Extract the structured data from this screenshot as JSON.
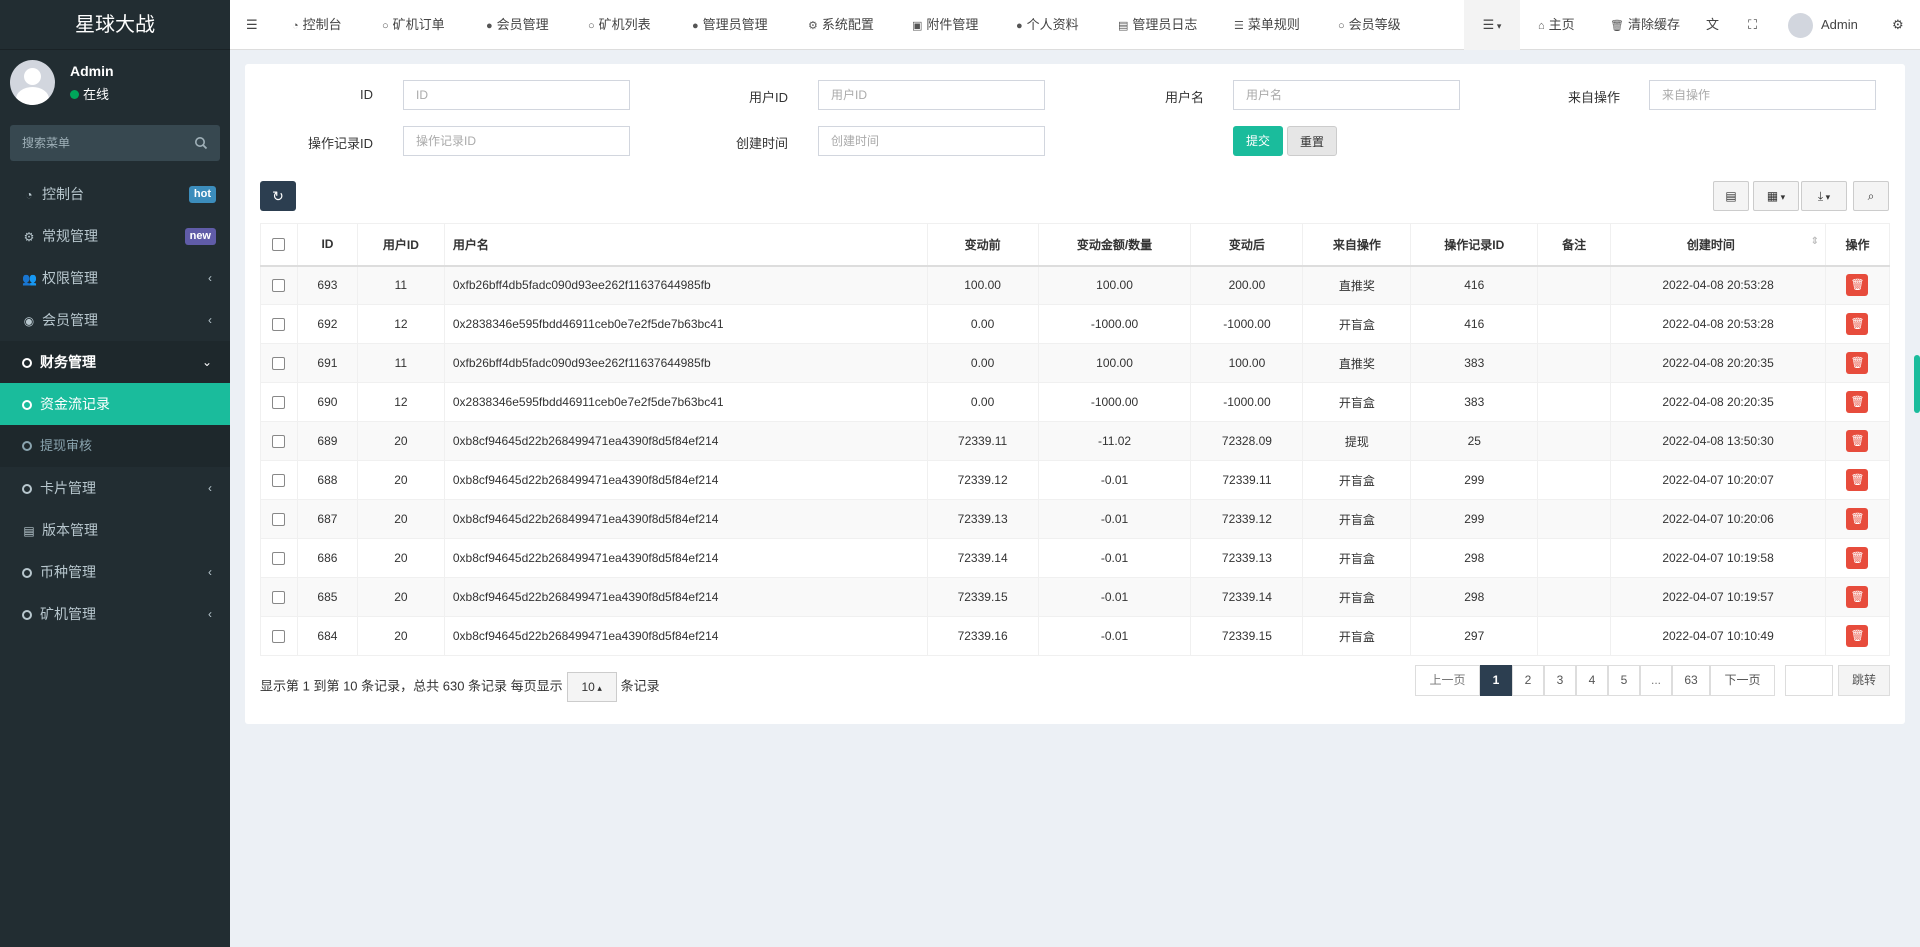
{
  "brand": "星球大战",
  "user": {
    "name": "Admin",
    "status": "在线"
  },
  "sidebar": {
    "search_placeholder": "搜索菜单",
    "items": [
      {
        "label": "控制台",
        "icon": "dashboard-icon",
        "badge": "hot",
        "badge_color": "#3c8dbc"
      },
      {
        "label": "常规管理",
        "icon": "cogs-icon",
        "badge": "new",
        "badge_color": "#605ca8"
      },
      {
        "label": "权限管理",
        "icon": "group-icon"
      },
      {
        "label": "会员管理",
        "icon": "user-circle-icon"
      },
      {
        "label": "财务管理",
        "icon": "circle-icon"
      },
      {
        "label": "资金流记录",
        "icon": "circle-icon"
      },
      {
        "label": "提现审核",
        "icon": "circle-icon"
      },
      {
        "label": "卡片管理",
        "icon": "circle-icon"
      },
      {
        "label": "版本管理",
        "icon": "file-icon"
      },
      {
        "label": "币种管理",
        "icon": "circle-icon"
      },
      {
        "label": "矿机管理",
        "icon": "circle-icon"
      }
    ]
  },
  "topnav": {
    "tabs": [
      "控制台",
      "矿机订单",
      "会员管理",
      "矿机列表",
      "管理员管理",
      "系统配置",
      "附件管理",
      "个人资料",
      "管理员日志",
      "菜单规则",
      "会员等级"
    ],
    "home": "主页",
    "clear_cache": "清除缓存",
    "admin": "Admin"
  },
  "filters": {
    "id_label": "ID",
    "id_placeholder": "ID",
    "uid_label": "用户ID",
    "uid_placeholder": "用户ID",
    "uname_label": "用户名",
    "uname_placeholder": "用户名",
    "from_label": "来自操作",
    "from_placeholder": "来自操作",
    "rec_label": "操作记录ID",
    "rec_placeholder": "操作记录ID",
    "time_label": "创建时间",
    "time_placeholder": "创建时间",
    "submit": "提交",
    "reset": "重置"
  },
  "table": {
    "headers": [
      "ID",
      "用户ID",
      "用户名",
      "变动前",
      "变动金额/数量",
      "变动后",
      "来自操作",
      "操作记录ID",
      "备注",
      "创建时间",
      "操作"
    ],
    "rows": [
      [
        "693",
        "11",
        "0xfb26bff4db5fadc090d93ee262f11637644985fb",
        "100.00",
        "100.00",
        "200.00",
        "直推奖",
        "416",
        "",
        "2022-04-08 20:53:28"
      ],
      [
        "692",
        "12",
        "0x2838346e595fbdd46911ceb0e7e2f5de7b63bc41",
        "0.00",
        "-1000.00",
        "-1000.00",
        "开盲盒",
        "416",
        "",
        "2022-04-08 20:53:28"
      ],
      [
        "691",
        "11",
        "0xfb26bff4db5fadc090d93ee262f11637644985fb",
        "0.00",
        "100.00",
        "100.00",
        "直推奖",
        "383",
        "",
        "2022-04-08 20:20:35"
      ],
      [
        "690",
        "12",
        "0x2838346e595fbdd46911ceb0e7e2f5de7b63bc41",
        "0.00",
        "-1000.00",
        "-1000.00",
        "开盲盒",
        "383",
        "",
        "2022-04-08 20:20:35"
      ],
      [
        "689",
        "20",
        "0xb8cf94645d22b268499471ea4390f8d5f84ef214",
        "72339.11",
        "-11.02",
        "72328.09",
        "提现",
        "25",
        "",
        "2022-04-08 13:50:30"
      ],
      [
        "688",
        "20",
        "0xb8cf94645d22b268499471ea4390f8d5f84ef214",
        "72339.12",
        "-0.01",
        "72339.11",
        "开盲盒",
        "299",
        "",
        "2022-04-07 10:20:07"
      ],
      [
        "687",
        "20",
        "0xb8cf94645d22b268499471ea4390f8d5f84ef214",
        "72339.13",
        "-0.01",
        "72339.12",
        "开盲盒",
        "299",
        "",
        "2022-04-07 10:20:06"
      ],
      [
        "686",
        "20",
        "0xb8cf94645d22b268499471ea4390f8d5f84ef214",
        "72339.14",
        "-0.01",
        "72339.13",
        "开盲盒",
        "298",
        "",
        "2022-04-07 10:19:58"
      ],
      [
        "685",
        "20",
        "0xb8cf94645d22b268499471ea4390f8d5f84ef214",
        "72339.15",
        "-0.01",
        "72339.14",
        "开盲盒",
        "298",
        "",
        "2022-04-07 10:19:57"
      ],
      [
        "684",
        "20",
        "0xb8cf94645d22b268499471ea4390f8d5f84ef214",
        "72339.16",
        "-0.01",
        "72339.15",
        "开盲盒",
        "297",
        "",
        "2022-04-07 10:10:49"
      ]
    ]
  },
  "footer": {
    "info_prefix": "显示第 1 到第 10 条记录，总共 630 条记录 每页显示",
    "page_size": "10",
    "info_suffix": "条记录"
  },
  "pagination": {
    "prev": "上一页",
    "pages": [
      "1",
      "2",
      "3",
      "4",
      "5",
      "...",
      "63"
    ],
    "next": "下一页",
    "go": "跳转",
    "current": "1"
  },
  "colors": {
    "sidebar_bg": "#222d32",
    "accent": "#1abc9c",
    "danger": "#e74c3c",
    "dark": "#2c3e50"
  }
}
